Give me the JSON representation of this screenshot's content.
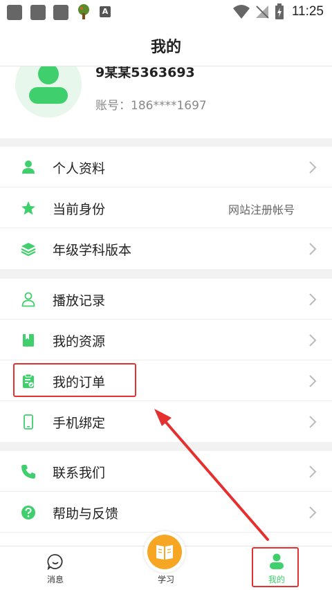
{
  "status_bar": {
    "time": "11:25",
    "icon_a": "A"
  },
  "header": {
    "title": "我的"
  },
  "profile": {
    "username": "9某某5363693",
    "account": "账号：186****1697"
  },
  "menu_groups": [
    [
      {
        "label": "个人资料",
        "icon": "person-icon",
        "value": "",
        "chevron": true
      },
      {
        "label": "当前身份",
        "icon": "star-icon",
        "value": "网站注册帐号",
        "chevron": false
      },
      {
        "label": "年级学科版本",
        "icon": "layers-icon",
        "value": "",
        "chevron": true
      }
    ],
    [
      {
        "label": "播放记录",
        "icon": "user-outline-icon",
        "value": "",
        "chevron": true
      },
      {
        "label": "我的资源",
        "icon": "book-icon",
        "value": "",
        "chevron": true
      },
      {
        "label": "我的订单",
        "icon": "order-clipboard-icon",
        "value": "",
        "chevron": true
      },
      {
        "label": "手机绑定",
        "icon": "phone-icon",
        "value": "",
        "chevron": true
      }
    ],
    [
      {
        "label": "联系我们",
        "icon": "telephone-icon",
        "value": "",
        "chevron": true
      },
      {
        "label": "帮助与反馈",
        "icon": "help-icon",
        "value": "",
        "chevron": true
      }
    ]
  ],
  "bottom_nav": {
    "messages": "消息",
    "study": "学习",
    "mine": "我的"
  },
  "colors": {
    "accent": "#3fcf6d",
    "study_orange": "#f6a623",
    "annotation_red": "#e53030"
  }
}
